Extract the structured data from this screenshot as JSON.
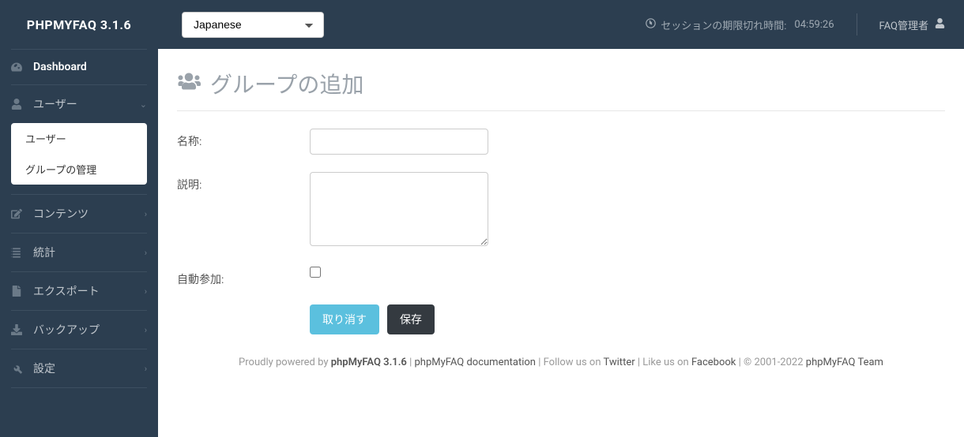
{
  "brand": "PHPMYFAQ 3.1.6",
  "language": {
    "selected": "Japanese"
  },
  "session": {
    "label": "セッションの期限切れ時間:",
    "value": "04:59:26"
  },
  "admin": {
    "label": "FAQ管理者"
  },
  "nav": {
    "dashboard": "Dashboard",
    "users": {
      "label": "ユーザー",
      "sub_users": "ユーザー",
      "sub_groups": "グループの管理"
    },
    "content": "コンテンツ",
    "stats": "統計",
    "export": "エクスポート",
    "backup": "バックアップ",
    "settings": "設定"
  },
  "page": {
    "title": "グループの追加",
    "fields": {
      "name_label": "名称:",
      "desc_label": "説明:",
      "auto_label": "自動参加:"
    },
    "buttons": {
      "cancel": "取り消す",
      "save": "保存"
    }
  },
  "footer": {
    "powered_pre": "Proudly powered by ",
    "powered_name": "phpMyFAQ 3.1.6",
    "doc_label": "phpMyFAQ documentation",
    "follow_pre": "Follow us on ",
    "twitter": "Twitter",
    "like_pre": "Like us on ",
    "facebook": "Facebook",
    "copyright": "© 2001-2022 ",
    "team": "phpMyFAQ Team"
  }
}
